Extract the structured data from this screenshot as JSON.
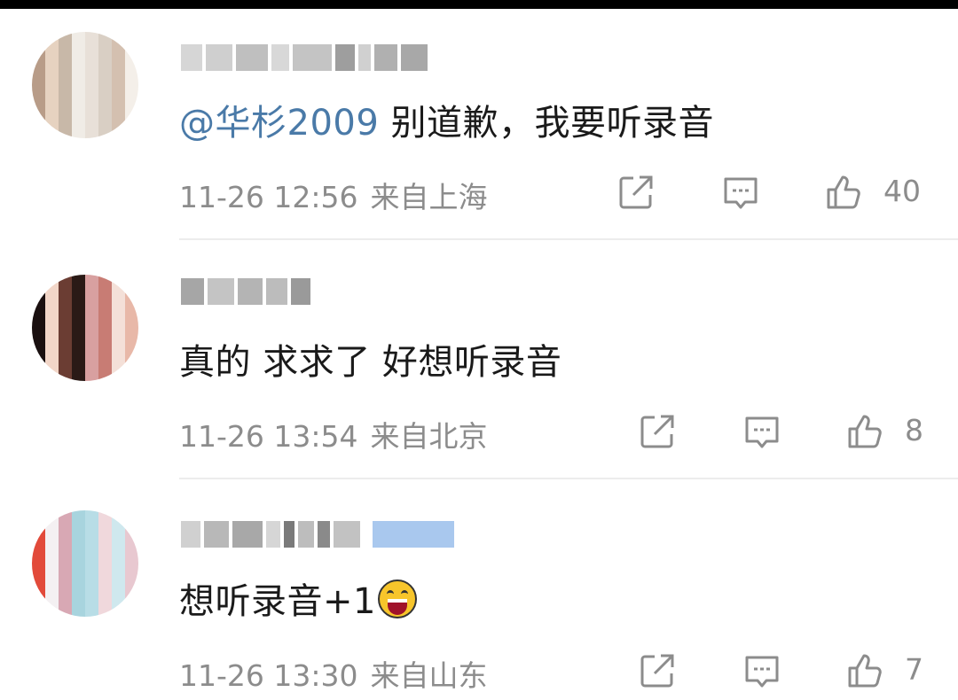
{
  "comments": [
    {
      "mention": "@华杉2009",
      "text": " 别道歉，我要听录音",
      "time": "11-26 12:56",
      "location": "来自上海",
      "likes": "40"
    },
    {
      "mention": "",
      "text": "真的 求求了 好想听录音",
      "time": "11-26 13:54",
      "location": "来自北京",
      "likes": "8"
    },
    {
      "mention": "",
      "text": "想听录音+1",
      "time": "11-26 13:30",
      "location": "来自山东",
      "likes": "7",
      "emoji": "laughing-emoji"
    }
  ],
  "icons": {
    "share": "share-icon",
    "reply": "comment-icon",
    "like": "thumbs-up-icon"
  },
  "colors": {
    "mention": "#4a7aa8",
    "text": "#1a1a1a",
    "meta": "#8c8c8c",
    "divider": "#ececec"
  }
}
